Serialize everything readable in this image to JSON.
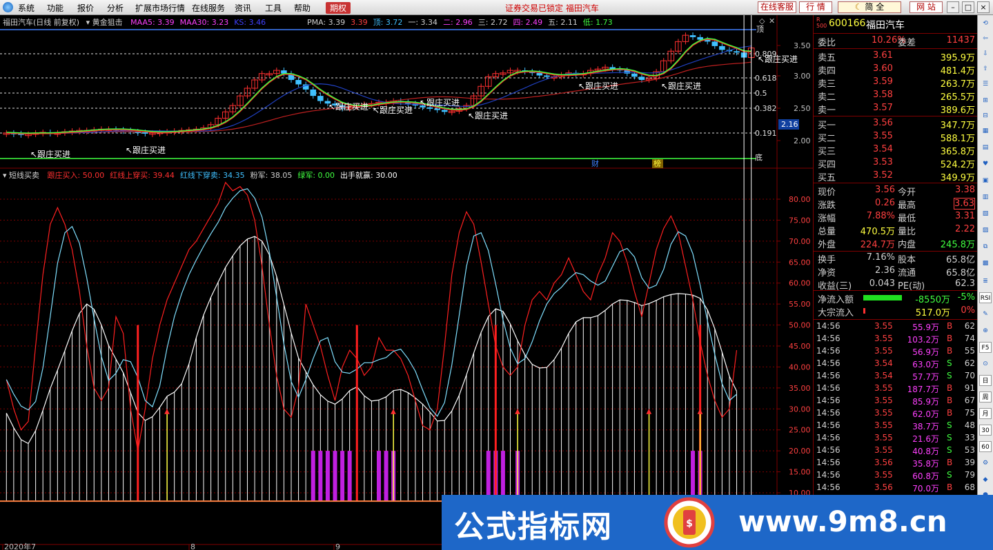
{
  "menu": {
    "items": [
      "系统",
      "功能",
      "报价",
      "分析",
      "扩展市场行情",
      "在线服务",
      "资讯",
      "工具",
      "帮助",
      "期权"
    ],
    "lock_text": "证券交易已锁定  福田汽车",
    "btn_service": "在线客服",
    "btn_quote": "行  情",
    "btn_jian": "简",
    "btn_quan": "全",
    "btn_site": "网  站"
  },
  "top_chart": {
    "title": "福田汽车(日线 前复权)",
    "indicator": "黄金狙击",
    "ma": [
      {
        "label": "MAA5: 3.39",
        "color": "#ff40ff"
      },
      {
        "label": "MAA30: 3.23",
        "color": "#ff40ff"
      },
      {
        "label": "KS: 3.46",
        "color": "#4040ff"
      }
    ],
    "pma": [
      {
        "label": "PMA: 3.39",
        "color": "#d0d0d0"
      },
      {
        "label": "3.39",
        "color": "#ff4040"
      },
      {
        "label": "顶: 3.72",
        "color": "#40c0ff"
      },
      {
        "label": "一: 3.34",
        "color": "#d0d0d0"
      },
      {
        "label": "二: 2.96",
        "color": "#ff40ff"
      },
      {
        "label": "三: 2.72",
        "color": "#d0d0d0"
      },
      {
        "label": "四: 2.49",
        "color": "#ff40ff"
      },
      {
        "label": "五: 2.11",
        "color": "#d0d0d0"
      },
      {
        "label": "低: 1.73",
        "color": "#40ff40"
      }
    ],
    "yaxis": [
      "3.50",
      "3.00",
      "2.50",
      "2.00"
    ],
    "fib": [
      "0.809",
      "0.618",
      "0.5",
      "0.382",
      "0.191"
    ],
    "price_tag": "2.16",
    "label_top": "顶",
    "label_bottom": "底",
    "signal": "跟庄买进",
    "marker_cai": "财",
    "marker_bang": "榜"
  },
  "bottom_chart": {
    "title": "短线买卖",
    "legend": [
      {
        "label": "跟庄买入: 50.00",
        "color": "#ff3030"
      },
      {
        "label": "红线上穿买: 39.44",
        "color": "#ff3030"
      },
      {
        "label": "红线下穿卖: 34.35",
        "color": "#40c0ff"
      },
      {
        "label": "粉军: 38.05",
        "color": "#d0d0d0"
      },
      {
        "label": "绿军: 0.00",
        "color": "#40ff40"
      },
      {
        "label": "出手就赢: 30.00",
        "color": "#ffffff"
      }
    ],
    "yaxis": [
      "80.00",
      "75.00",
      "70.00",
      "65.00",
      "60.00",
      "55.00",
      "50.00",
      "45.00",
      "40.00",
      "35.00",
      "30.00",
      "25.00",
      "20.00",
      "15.00",
      "10.00"
    ]
  },
  "xaxis": {
    "labels": [
      "2020年7",
      "8",
      "9"
    ]
  },
  "quote": {
    "code": "600166",
    "name": "福田汽车",
    "weibi_label": "委比",
    "weibi": "10.26%",
    "weicha_label": "委差",
    "weicha": "11437",
    "sell": [
      {
        "label": "卖五",
        "price": "3.61",
        "vol": "395.9万"
      },
      {
        "label": "卖四",
        "price": "3.60",
        "vol": "481.4万"
      },
      {
        "label": "卖三",
        "price": "3.59",
        "vol": "263.7万"
      },
      {
        "label": "卖二",
        "price": "3.58",
        "vol": "265.5万"
      },
      {
        "label": "卖一",
        "price": "3.57",
        "vol": "389.6万"
      }
    ],
    "buy": [
      {
        "label": "买一",
        "price": "3.56",
        "vol": "347.7万"
      },
      {
        "label": "买二",
        "price": "3.55",
        "vol": "588.1万"
      },
      {
        "label": "买三",
        "price": "3.54",
        "vol": "365.8万"
      },
      {
        "label": "买四",
        "price": "3.53",
        "vol": "524.2万"
      },
      {
        "label": "买五",
        "price": "3.52",
        "vol": "349.9万"
      }
    ],
    "stats": [
      {
        "l1": "现价",
        "v1": "3.56",
        "l2": "今开",
        "v2": "3.38"
      },
      {
        "l1": "涨跌",
        "v1": "0.26",
        "l2": "最高",
        "v2": "3.63"
      },
      {
        "l1": "涨幅",
        "v1": "7.88%",
        "l2": "最低",
        "v2": "3.31"
      },
      {
        "l1": "总量",
        "v1": "470.5万",
        "l2": "量比",
        "v2": "2.22"
      },
      {
        "l1": "外盘",
        "v1": "224.7万",
        "l2": "内盘",
        "v2": "245.8万"
      },
      {
        "l1": "换手",
        "v1": "7.16%",
        "l2": "股本",
        "v2": "65.8亿"
      },
      {
        "l1": "净资",
        "v1": "2.36",
        "l2": "流通",
        "v2": "65.8亿"
      },
      {
        "l1": "收益(三)",
        "v1": "0.043",
        "l2": "PE(动)",
        "v2": "62.3"
      }
    ],
    "flow": [
      {
        "label": "净流入额",
        "value": "-8550万",
        "pct": "-5%"
      },
      {
        "label": "大宗流入",
        "value": "517.0万",
        "pct": "0%"
      }
    ],
    "ticks": [
      {
        "t": "14:56",
        "p": "3.55",
        "v": "55.9万",
        "d": "B",
        "n": "62"
      },
      {
        "t": "14:56",
        "p": "3.55",
        "v": "103.2万",
        "d": "B",
        "n": "74"
      },
      {
        "t": "14:56",
        "p": "3.55",
        "v": "56.9万",
        "d": "B",
        "n": "55"
      },
      {
        "t": "14:56",
        "p": "3.54",
        "v": "63.0万",
        "d": "S",
        "n": "62"
      },
      {
        "t": "14:56",
        "p": "3.54",
        "v": "57.7万",
        "d": "S",
        "n": "70"
      },
      {
        "t": "14:56",
        "p": "3.55",
        "v": "187.7万",
        "d": "B",
        "n": "91"
      },
      {
        "t": "14:56",
        "p": "3.55",
        "v": "85.9万",
        "d": "B",
        "n": "67"
      },
      {
        "t": "14:56",
        "p": "3.55",
        "v": "62.0万",
        "d": "B",
        "n": "75"
      },
      {
        "t": "14:56",
        "p": "3.55",
        "v": "38.7万",
        "d": "S",
        "n": "48"
      },
      {
        "t": "14:56",
        "p": "3.55",
        "v": "21.6万",
        "d": "S",
        "n": "33"
      },
      {
        "t": "14:56",
        "p": "3.55",
        "v": "40.8万",
        "d": "S",
        "n": "53"
      },
      {
        "t": "14:56",
        "p": "3.56",
        "v": "35.8万",
        "d": "B",
        "n": "39"
      },
      {
        "t": "14:56",
        "p": "3.55",
        "v": "60.8万",
        "d": "S",
        "n": "79"
      },
      {
        "t": "14:56",
        "p": "3.56",
        "v": "70.0万",
        "d": "B",
        "n": "68"
      }
    ]
  },
  "toolbar": [
    "RSI",
    "F5",
    "日",
    "周",
    "月",
    "30",
    "60"
  ],
  "watermark": {
    "left": "公式指标网",
    "right": "www.9m8.cn"
  }
}
